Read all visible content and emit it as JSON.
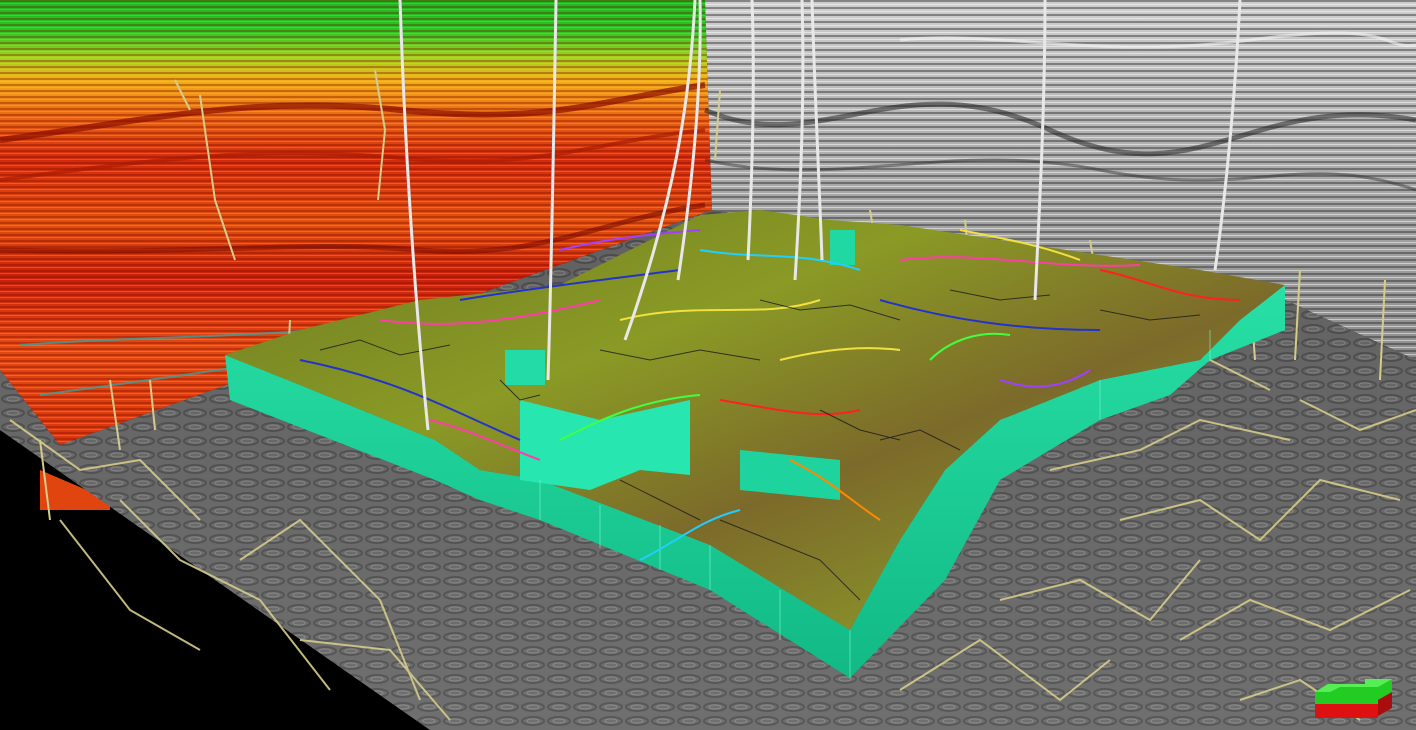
{
  "scene": {
    "description_tags": [
      "seismic-section-colored",
      "seismic-section-grayscale",
      "seismic-horizon-slice",
      "fault-framework-model",
      "well-trajectories",
      "orientation-cube"
    ]
  },
  "colors": {
    "background": "#000000",
    "model_side": "#19d59a",
    "model_side_dark": "#11b884",
    "model_top_light": "#8fae2a",
    "model_top_dark": "#6a6a22",
    "fault_trace": "#d9d28a",
    "well": "#e8e8e8",
    "cube_green": "#22cc22",
    "cube_red": "#dd1111"
  }
}
